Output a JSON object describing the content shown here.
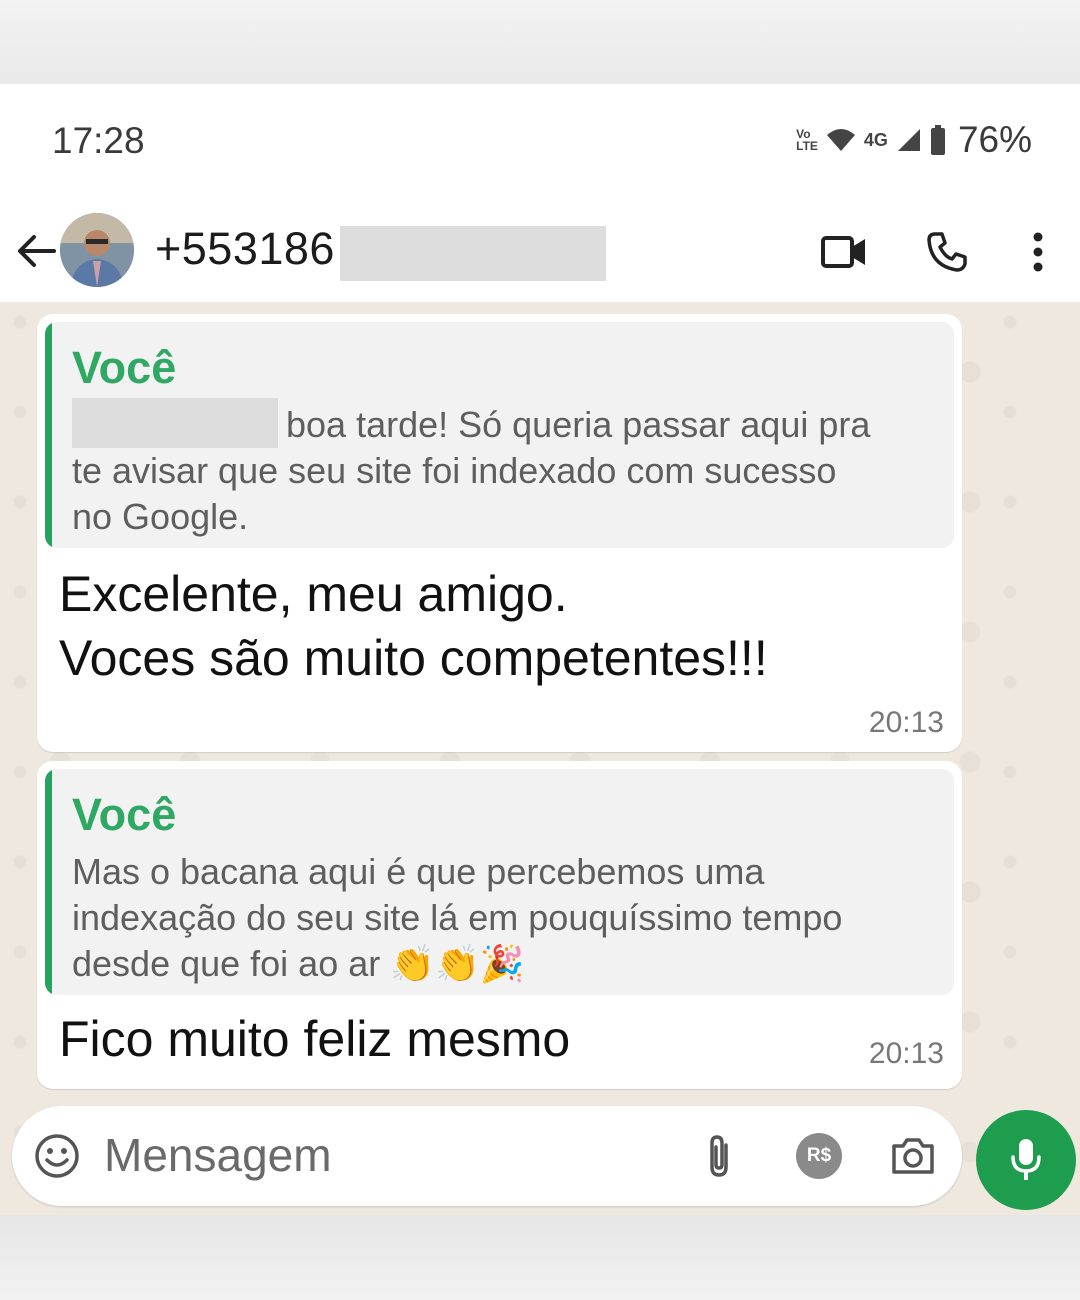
{
  "status_bar": {
    "time": "17:28",
    "volte_top": "Vo",
    "volte_bottom": "LTE",
    "network": "4G",
    "battery": "76%"
  },
  "header": {
    "contact_number": "+553186"
  },
  "messages": [
    {
      "quote_author": "Você",
      "quote_line1": "boa tarde! Só queria passar aqui pra",
      "quote_line2": "te avisar que seu site foi indexado com sucesso",
      "quote_line3": "no Google.",
      "text_line1": "Excelente, meu amigo.",
      "text_line2": "Voces são muito competentes!!!",
      "time": "20:13"
    },
    {
      "quote_author": "Você",
      "quote_line1": "Mas o bacana aqui é que percebemos uma",
      "quote_line2": "indexação do seu site lá em pouquíssimo tempo",
      "quote_line3": "desde que foi ao ar 👏👏🎉",
      "text_line1": "Fico muito feliz mesmo",
      "time": "20:13"
    }
  ],
  "composer": {
    "placeholder": "Mensagem",
    "rs_badge": "R$"
  },
  "colors": {
    "accent_green": "#1f9d4f",
    "quote_author_green": "#2fa863",
    "chat_background": "#efe8df"
  }
}
